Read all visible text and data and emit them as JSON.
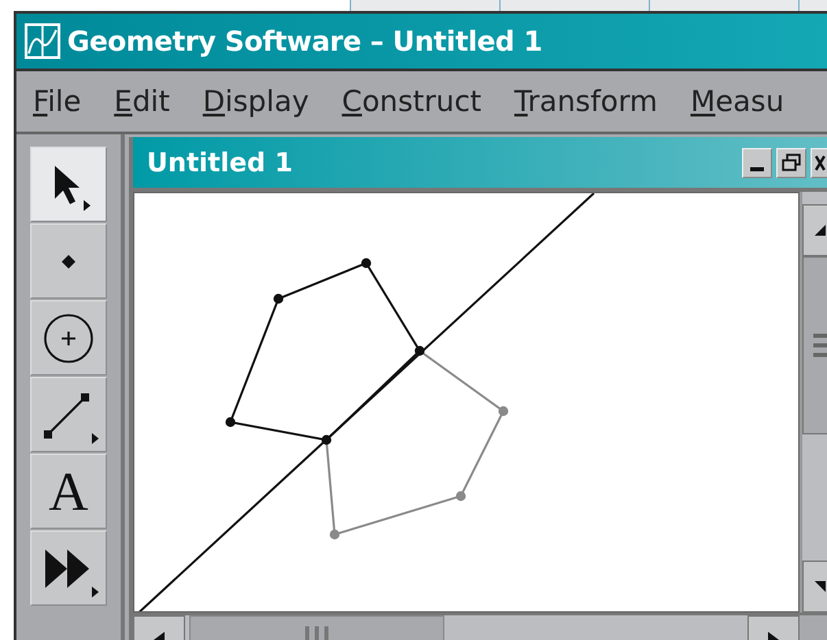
{
  "window": {
    "title": "Geometry Software – Untitled 1"
  },
  "menu": [
    "File",
    "Edit",
    "Display",
    "Construct",
    "Transform",
    "Measu"
  ],
  "tools": [
    {
      "kind": "arrow",
      "selected": true
    },
    {
      "kind": "point",
      "selected": false
    },
    {
      "kind": "compass",
      "selected": false
    },
    {
      "kind": "segment",
      "selected": false
    },
    {
      "kind": "text",
      "label": "A",
      "selected": false
    },
    {
      "kind": "custom",
      "selected": false
    }
  ],
  "document": {
    "title": "Untitled 1"
  }
}
